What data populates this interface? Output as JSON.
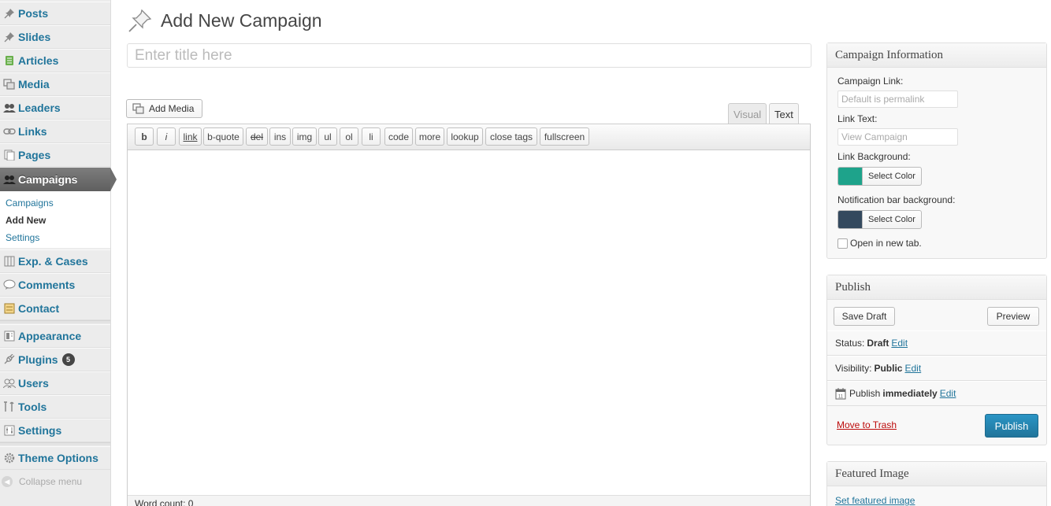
{
  "sidebar": {
    "items": [
      {
        "label": "Posts",
        "icon": "pushpin-icon"
      },
      {
        "label": "Slides",
        "icon": "pushpin-icon"
      },
      {
        "label": "Articles",
        "icon": "articles-icon"
      },
      {
        "label": "Media",
        "icon": "media-icon"
      },
      {
        "label": "Leaders",
        "icon": "users-icon"
      },
      {
        "label": "Links",
        "icon": "link-icon"
      },
      {
        "label": "Pages",
        "icon": "pages-icon"
      },
      {
        "label": "Campaigns",
        "icon": "users-icon"
      },
      {
        "label": "Exp. & Cases",
        "icon": "grid-icon"
      },
      {
        "label": "Comments",
        "icon": "comment-icon"
      },
      {
        "label": "Contact",
        "icon": "contact-icon"
      },
      {
        "label": "Appearance",
        "icon": "appearance-icon"
      },
      {
        "label": "Plugins",
        "icon": "plug-icon"
      },
      {
        "label": "Users",
        "icon": "users-icon"
      },
      {
        "label": "Tools",
        "icon": "tools-icon"
      },
      {
        "label": "Settings",
        "icon": "settings-icon"
      },
      {
        "label": "Theme Options",
        "icon": "gear-icon"
      }
    ],
    "plugins_badge": "5",
    "submenu": [
      "Campaigns",
      "Add New",
      "Settings"
    ],
    "collapse_label": "Collapse menu"
  },
  "page": {
    "title": "Add New Campaign",
    "title_placeholder": "Enter title here"
  },
  "editor": {
    "add_media": "Add Media",
    "tab_visual": "Visual",
    "tab_text": "Text",
    "quicktags": [
      "b",
      "i",
      "link",
      "b-quote",
      "del",
      "ins",
      "img",
      "ul",
      "ol",
      "li",
      "code",
      "more",
      "lookup",
      "close tags",
      "fullscreen"
    ],
    "word_count": "Word count: 0"
  },
  "campaign_info": {
    "heading": "Campaign Information",
    "link_label": "Campaign Link:",
    "link_placeholder": "Default is permalink",
    "text_label": "Link Text:",
    "text_placeholder": "View Campaign",
    "bg_label": "Link Background:",
    "bg_color": "#1ea38b",
    "notif_label": "Notification bar background:",
    "notif_color": "#34495e",
    "select_color": "Select Color",
    "new_tab_label": "Open in new tab."
  },
  "publish": {
    "heading": "Publish",
    "save_draft": "Save Draft",
    "preview": "Preview",
    "status_label": "Status:",
    "status_value": "Draft",
    "visibility_label": "Visibility:",
    "visibility_value": "Public",
    "schedule_label": "Publish",
    "schedule_value": "immediately",
    "edit": "Edit",
    "trash": "Move to Trash",
    "publish_btn": "Publish"
  },
  "featured": {
    "heading": "Featured Image",
    "link": "Set featured image"
  },
  "colors": {
    "link": "#21759b",
    "current_menu": "#6e6e6e",
    "publish_button": "#21759b",
    "trash": "#bc0b0b"
  }
}
